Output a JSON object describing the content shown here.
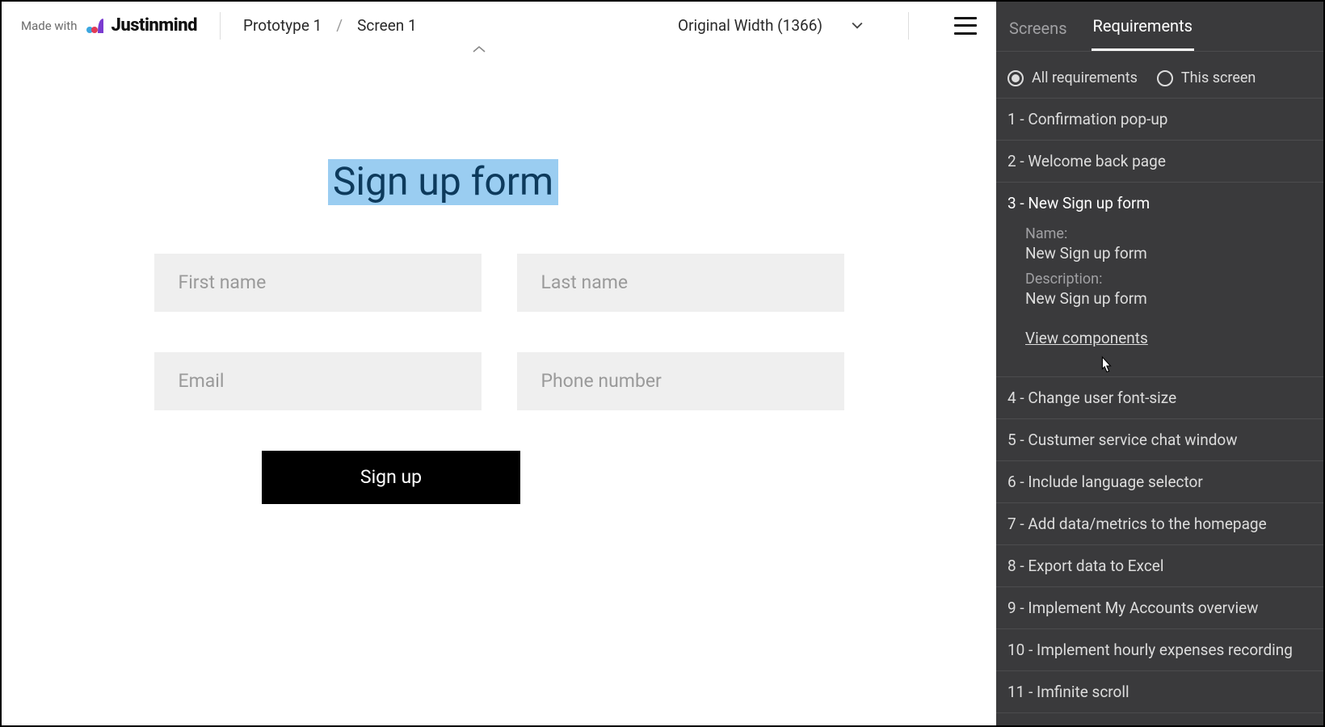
{
  "header": {
    "made_with": "Made with",
    "brand": "Justinmind",
    "crumb1": "Prototype 1",
    "crumb_sep": "/",
    "crumb2": "Screen 1",
    "width_selector": "Original Width (1366)"
  },
  "form": {
    "title": "Sign up form",
    "first_name_ph": "First name",
    "last_name_ph": "Last name",
    "email_ph": "Email",
    "phone_ph": "Phone number",
    "submit_label": "Sign up"
  },
  "panel": {
    "tabs": {
      "screens": "Screens",
      "requirements": "Requirements"
    },
    "filters": {
      "all": "All requirements",
      "this": "This screen"
    },
    "requirements": [
      {
        "label": "1 - Confirmation pop-up"
      },
      {
        "label": "2 - Welcome back page"
      },
      {
        "label": "3 - New Sign up form"
      },
      {
        "label": "4 - Change user font-size"
      },
      {
        "label": "5 - Custumer service chat window"
      },
      {
        "label": "6 - Include language selector"
      },
      {
        "label": "7 - Add data/metrics to the homepage"
      },
      {
        "label": "8 - Export data to Excel"
      },
      {
        "label": "9 - Implement My Accounts overview"
      },
      {
        "label": "10 - Implement hourly expenses recording"
      },
      {
        "label": "11 - Imfinite scroll"
      }
    ],
    "selected": {
      "name_label": "Name:",
      "name_value": "New Sign up form",
      "desc_label": "Description:",
      "desc_value": "New Sign up form",
      "view_components": "View components"
    }
  }
}
